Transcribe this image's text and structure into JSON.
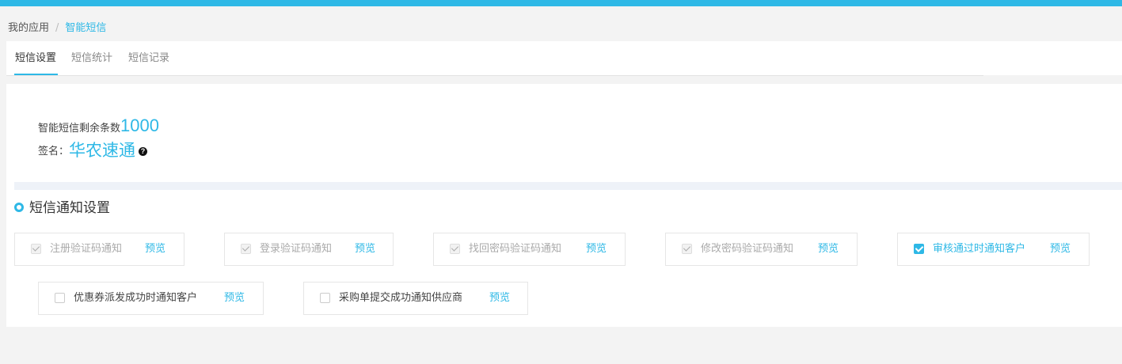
{
  "breadcrumb": {
    "root": "我的应用",
    "separator": "/",
    "current": "智能短信"
  },
  "tabs": [
    {
      "label": "短信设置",
      "active": true
    },
    {
      "label": "短信统计",
      "active": false
    },
    {
      "label": "短信记录",
      "active": false
    }
  ],
  "quota": {
    "label": "智能短信剩余条数",
    "value": "1000"
  },
  "signature": {
    "label": "签名：",
    "value": "华农速通",
    "help_icon": "question-circle-icon"
  },
  "section": {
    "title": "短信通知设置"
  },
  "options": [
    {
      "label": "注册验证码通知",
      "preview": "预览",
      "checked": true,
      "disabled": true
    },
    {
      "label": "登录验证码通知",
      "preview": "预览",
      "checked": true,
      "disabled": true
    },
    {
      "label": "找回密码验证码通知",
      "preview": "预览",
      "checked": true,
      "disabled": true
    },
    {
      "label": "修改密码验证码通知",
      "preview": "预览",
      "checked": true,
      "disabled": true
    },
    {
      "label": "审核通过时通知客户",
      "preview": "预览",
      "checked": true,
      "disabled": false
    },
    {
      "label": "优惠券派发成功时通知客户",
      "preview": "预览",
      "checked": false,
      "disabled": false
    },
    {
      "label": "采购单提交成功通知供应商",
      "preview": "预览",
      "checked": false,
      "disabled": false
    }
  ],
  "colors": {
    "accent": "#2eb8e6",
    "background": "#f3f3f3",
    "panel": "#ffffff"
  }
}
